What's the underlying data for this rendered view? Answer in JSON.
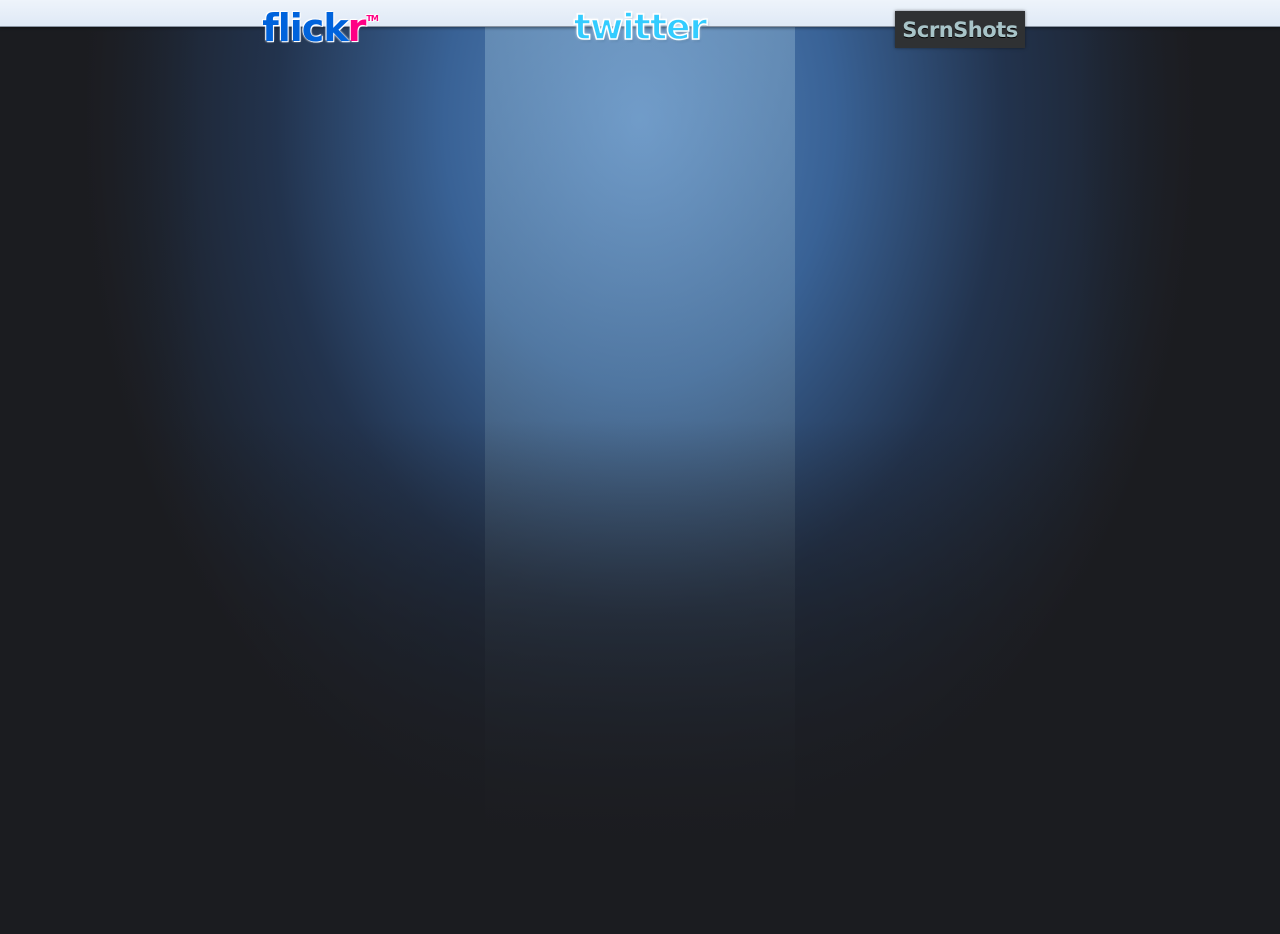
{
  "tabs": [
    {
      "id": "flickr",
      "label": "flickr",
      "label_main": "flick",
      "label_accent": "r",
      "trademark": "TM",
      "colors": {
        "primary": "#0063dc",
        "accent": "#ff0084"
      }
    },
    {
      "id": "twitter",
      "label": "twitter",
      "colors": {
        "primary": "#33ccff"
      }
    },
    {
      "id": "scrnshots",
      "label": "ScrnShots",
      "colors": {
        "background": "#2f3133",
        "text": "#a8c4c8"
      }
    }
  ],
  "theme": {
    "background": "#1b1c20",
    "topbar": "#e6eef9",
    "glow": "#5a8cc8"
  }
}
